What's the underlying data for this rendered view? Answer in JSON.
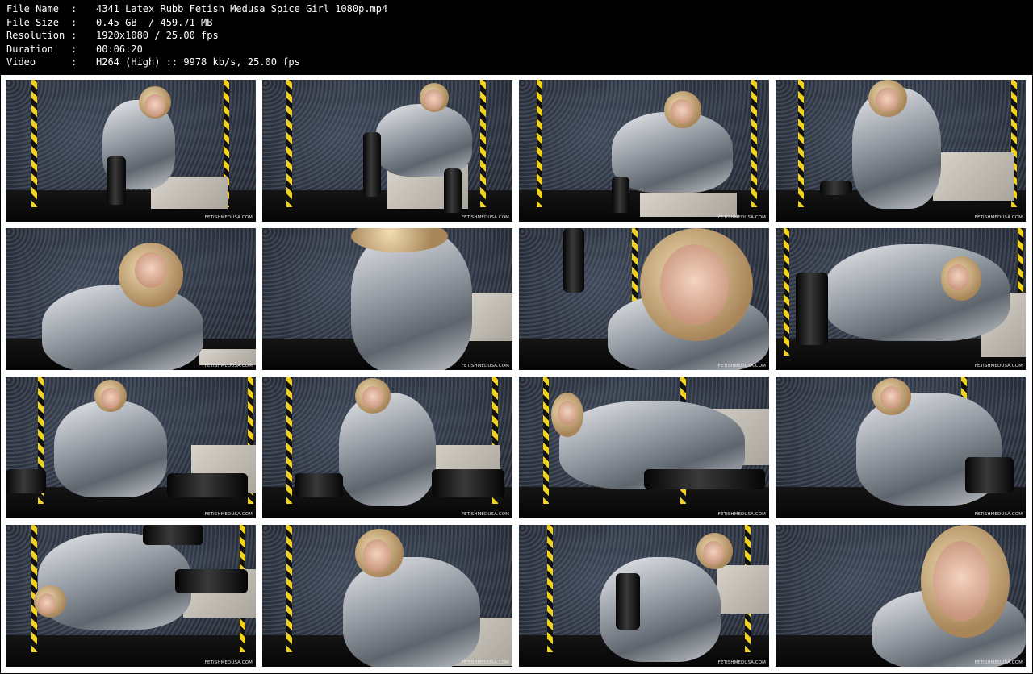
{
  "file_info": [
    {
      "key": "File Name",
      "value": "4341 Latex Rubb Fetish Medusa Spice Girl 1080p.mp4"
    },
    {
      "key": "File Size",
      "value": "0.45 GB  / 459.71 MB"
    },
    {
      "key": "Resolution",
      "value": "1920x1080 / 25.00 fps"
    },
    {
      "key": "Duration",
      "value": "00:06:20"
    },
    {
      "key": "Video",
      "value": "H264 (High) :: 9978 kb/s, 25.00 fps"
    }
  ],
  "separator": ":",
  "watermark": "FETISHMEDUSA.COM",
  "thumbnails": [
    {
      "scene": "seated-on-block-wide"
    },
    {
      "scene": "seated-leg-raised"
    },
    {
      "scene": "reclined-on-block"
    },
    {
      "scene": "kneeling-floor"
    },
    {
      "scene": "closeup-chest"
    },
    {
      "scene": "closeup-torso"
    },
    {
      "scene": "closeup-face-open-mouth"
    },
    {
      "scene": "lying-side-legs-up"
    },
    {
      "scene": "sitting-floor-legs-apart"
    },
    {
      "scene": "sitting-floor-knee-up"
    },
    {
      "scene": "lying-side-floor"
    },
    {
      "scene": "reclined-back-view"
    },
    {
      "scene": "lying-back-legs-up"
    },
    {
      "scene": "closeup-upper-body"
    },
    {
      "scene": "kneeling-looking-back"
    },
    {
      "scene": "closeup-face-finger"
    }
  ]
}
